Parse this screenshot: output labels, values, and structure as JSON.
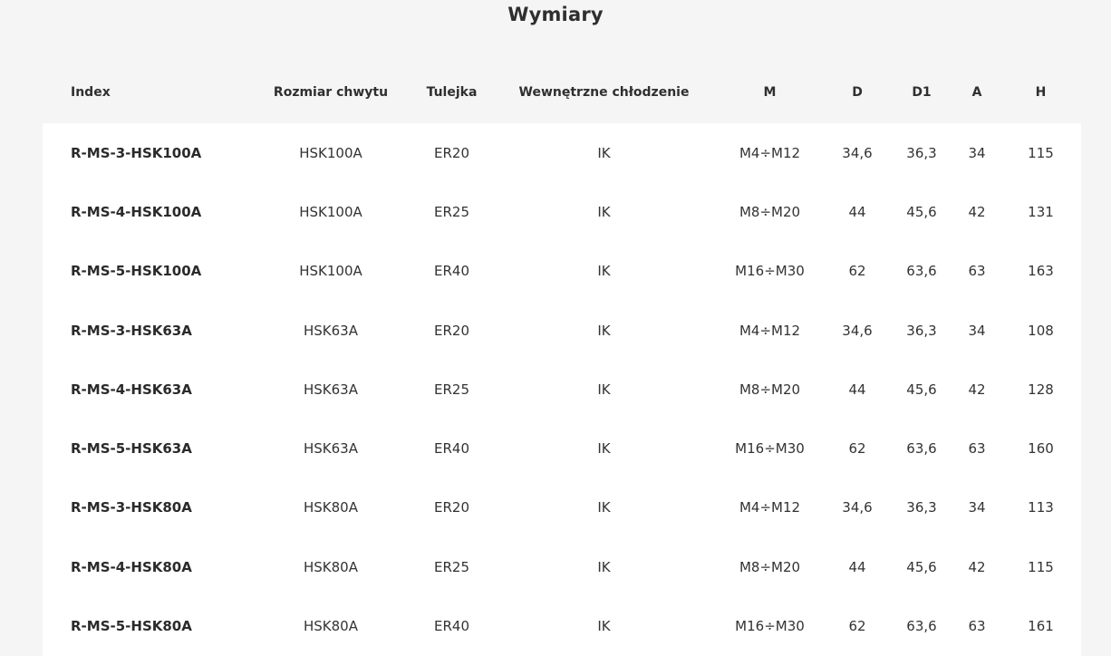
{
  "header": {
    "title": "Wymiary"
  },
  "table": {
    "columns": [
      "Index",
      "Rozmiar chwytu",
      "Tulejka",
      "Wewnętrzne chłodzenie",
      "M",
      "D",
      "D1",
      "A",
      "H"
    ],
    "rows": [
      [
        "R-MS-3-HSK100A",
        "HSK100A",
        "ER20",
        "IK",
        "M4÷M12",
        "34,6",
        "36,3",
        "34",
        "115"
      ],
      [
        "R-MS-4-HSK100A",
        "HSK100A",
        "ER25",
        "IK",
        "M8÷M20",
        "44",
        "45,6",
        "42",
        "131"
      ],
      [
        "R-MS-5-HSK100A",
        "HSK100A",
        "ER40",
        "IK",
        "M16÷M30",
        "62",
        "63,6",
        "63",
        "163"
      ],
      [
        "R-MS-3-HSK63A",
        "HSK63A",
        "ER20",
        "IK",
        "M4÷M12",
        "34,6",
        "36,3",
        "34",
        "108"
      ],
      [
        "R-MS-4-HSK63A",
        "HSK63A",
        "ER25",
        "IK",
        "M8÷M20",
        "44",
        "45,6",
        "42",
        "128"
      ],
      [
        "R-MS-5-HSK63A",
        "HSK63A",
        "ER40",
        "IK",
        "M16÷M30",
        "62",
        "63,6",
        "63",
        "160"
      ],
      [
        "R-MS-3-HSK80A",
        "HSK80A",
        "ER20",
        "IK",
        "M4÷M12",
        "34,6",
        "36,3",
        "34",
        "113"
      ],
      [
        "R-MS-4-HSK80A",
        "HSK80A",
        "ER25",
        "IK",
        "M8÷M20",
        "44",
        "45,6",
        "42",
        "115"
      ],
      [
        "R-MS-5-HSK80A",
        "HSK80A",
        "ER40",
        "IK",
        "M16÷M30",
        "62",
        "63,6",
        "63",
        "161"
      ]
    ]
  }
}
